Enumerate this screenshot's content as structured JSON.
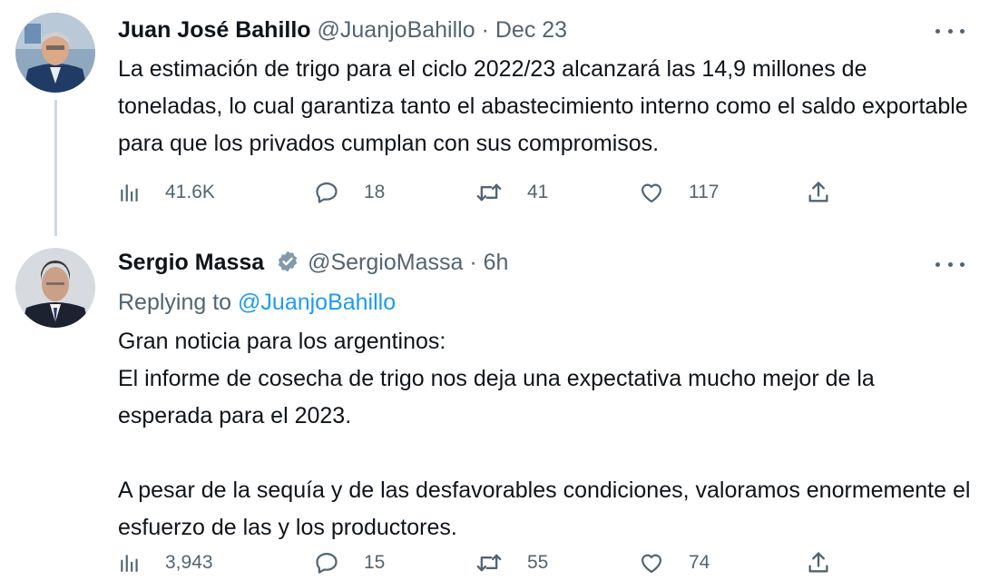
{
  "tweets": [
    {
      "name": "Juan José Bahillo",
      "handle": "@JuanjoBahillo",
      "separator": "·",
      "time": "Dec 23",
      "text": [
        "La estimación de trigo para el ciclo 2022/23 alcanzará las 14,9 millones de toneladas, lo cual garantiza tanto el abastecimiento interno como el saldo exportable para que los privados cumplan con sus compromisos."
      ],
      "stats": {
        "views": "41.6K",
        "replies": "18",
        "retweets": "41",
        "likes": "117"
      }
    },
    {
      "name": "Sergio Massa",
      "verified": true,
      "handle": "@SergioMassa",
      "separator": "·",
      "time": "6h",
      "replying_to_label": "Replying to",
      "replying_to_handle": "@JuanjoBahillo",
      "text": [
        "Gran noticia para los argentinos:",
        "El informe de cosecha de trigo nos deja una expectativa mucho mejor de la esperada para el 2023.",
        "A pesar de la sequía y de las desfavorables condiciones, valoramos enormemente el esfuerzo de las y los productores."
      ],
      "stats": {
        "views": "3,943",
        "replies": "15",
        "retweets": "55",
        "likes": "74"
      }
    }
  ],
  "colors": {
    "text": "#0f1419",
    "muted": "#536471",
    "link": "#1d9bf0",
    "thread_line": "#cfd9de"
  },
  "icons": [
    "views-icon",
    "reply-icon",
    "retweet-icon",
    "like-icon",
    "share-icon",
    "more-icon",
    "verified-badge-icon"
  ]
}
